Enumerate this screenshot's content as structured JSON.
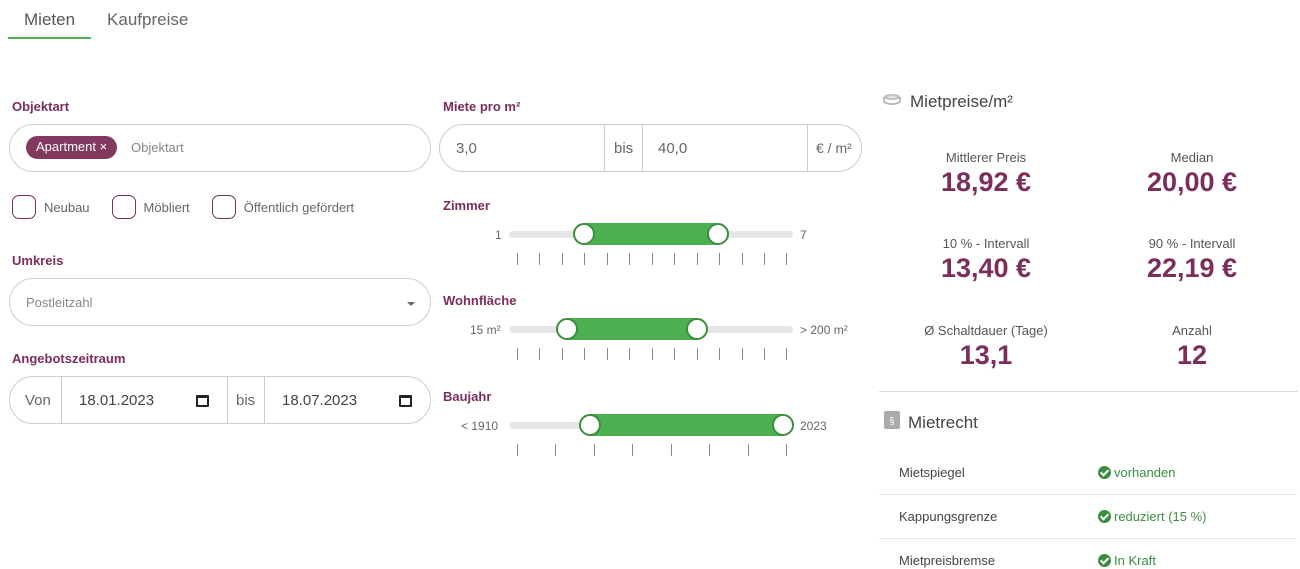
{
  "tabs": [
    {
      "label": "Mieten",
      "active": true
    },
    {
      "label": "Kaufpreise",
      "active": false
    }
  ],
  "objektart": {
    "label": "Objektart",
    "selected_tag": "Apartment ×",
    "placeholder": "Objektart"
  },
  "checkboxes": [
    {
      "label": "Neubau",
      "checked": false
    },
    {
      "label": "Möbliert",
      "checked": false
    },
    {
      "label": "Öffentlich gefördert",
      "checked": false
    }
  ],
  "umkreis": {
    "label": "Umkreis",
    "placeholder": "Postleitzahl"
  },
  "angebotszeitraum": {
    "label": "Angebotszeitraum",
    "from_label": "Von",
    "from_value": "18.01.2023",
    "bis_label": "bis",
    "to_value": "18.07.2023"
  },
  "miete_pro_m2": {
    "label": "Miete pro m²",
    "min_value": "3,0",
    "bis_label": "bis",
    "max_value": "40,0",
    "unit": "€ / m²"
  },
  "zimmer": {
    "label": "Zimmer",
    "min_label": "1",
    "max_label": "7",
    "range_min": 1,
    "range_max": 7,
    "selected_low": 2.5,
    "selected_high": 6
  },
  "wohnflaeche": {
    "label": "Wohnfläche",
    "min_label": "15 m²",
    "max_label": "> 200 m²",
    "selected_low_fraction": 0.2,
    "selected_high_fraction": 0.65
  },
  "baujahr": {
    "label": "Baujahr",
    "min_label": "< 1910",
    "max_label": "2023",
    "selected_low_fraction": 0.29,
    "selected_high_fraction": 1.0
  },
  "mietpreise": {
    "title": "Mietpreise/m²",
    "stats": [
      {
        "label": "Mittlerer Preis",
        "value": "18,92 €"
      },
      {
        "label": "Median",
        "value": "20,00 €"
      },
      {
        "label": "10 % - Intervall",
        "value": "13,40 €"
      },
      {
        "label": "90 % - Intervall",
        "value": "22,19 €"
      },
      {
        "label": "Ø Schaltdauer (Tage)",
        "value": "13,1"
      },
      {
        "label": "Anzahl",
        "value": "12"
      }
    ]
  },
  "mietrecht": {
    "title": "Mietrecht",
    "rows": [
      {
        "name": "Mietspiegel",
        "status": "vorhanden"
      },
      {
        "name": "Kappungsgrenze",
        "status": "reduziert (15 %)"
      },
      {
        "name": "Mietpreisbremse",
        "status": "In Kraft"
      }
    ]
  },
  "colors": {
    "accent_purple": "#7b2d5b",
    "tag_purple": "#82395f",
    "slider_green": "#4caf50",
    "status_green": "#3c8d3f"
  }
}
